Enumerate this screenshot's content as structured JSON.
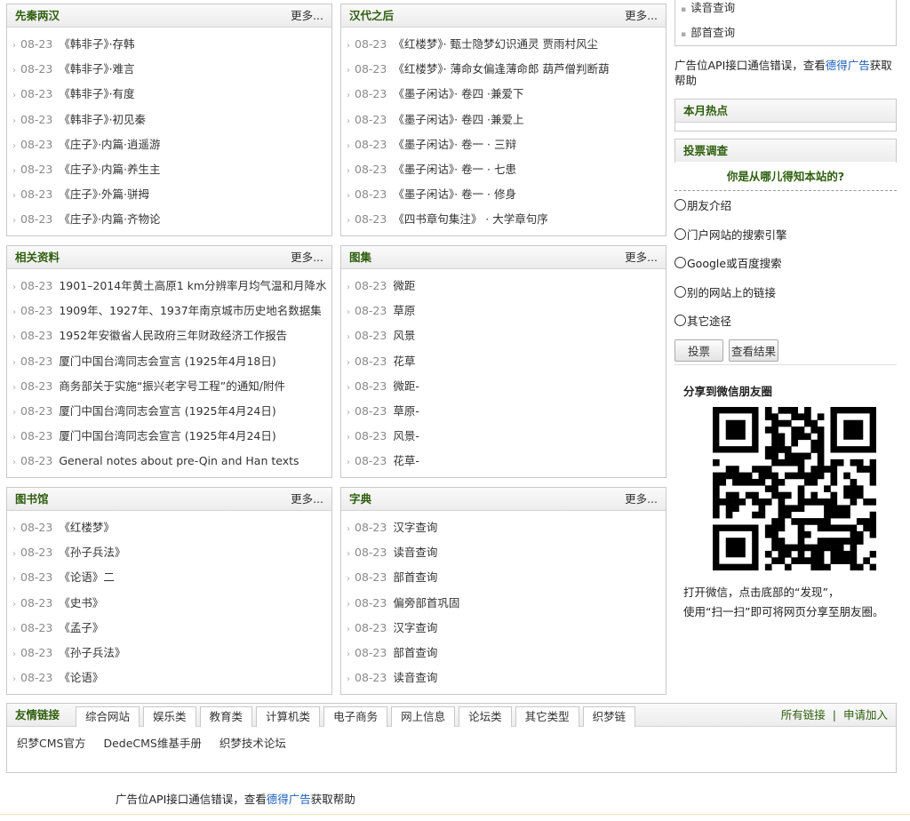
{
  "panels": [
    {
      "title": "先秦两汉",
      "more": "更多...",
      "items": [
        {
          "date": "08-23",
          "text": "《韩非子》·存韩"
        },
        {
          "date": "08-23",
          "text": "《韩非子》·难言"
        },
        {
          "date": "08-23",
          "text": "《韩非子》·有度"
        },
        {
          "date": "08-23",
          "text": "《韩非子》·初见秦"
        },
        {
          "date": "08-23",
          "text": "《庄子》·内篇·逍遥游"
        },
        {
          "date": "08-23",
          "text": "《庄子》·内篇·养生主"
        },
        {
          "date": "08-23",
          "text": "《庄子》·外篇·骈拇"
        },
        {
          "date": "08-23",
          "text": "《庄子》·内篇·齐物论"
        }
      ]
    },
    {
      "title": "汉代之后",
      "more": "更多...",
      "items": [
        {
          "date": "08-23",
          "text": "《红楼梦》· 甄士隐梦幻识通灵  贾雨村风尘"
        },
        {
          "date": "08-23",
          "text": "《红楼梦》· 薄命女偏逢薄命郎  葫芦僧判断葫"
        },
        {
          "date": "08-23",
          "text": "《墨子闲诂》· 卷四 ·兼爱下"
        },
        {
          "date": "08-23",
          "text": "《墨子闲诂》· 卷四 ·兼爱上"
        },
        {
          "date": "08-23",
          "text": "《墨子闲诂》· 卷一 · 三辩"
        },
        {
          "date": "08-23",
          "text": "《墨子闲诂》· 卷一 · 七患"
        },
        {
          "date": "08-23",
          "text": "《墨子闲诂》· 卷一 · 修身"
        },
        {
          "date": "08-23",
          "text": "《四书章句集注》 · 大学章句序"
        }
      ]
    },
    {
      "title": "相关资料",
      "more": "更多...",
      "items": [
        {
          "date": "08-23",
          "text": "1901–2014年黄土高原1 km分辨率月均气温和月降水"
        },
        {
          "date": "08-23",
          "text": "1909年、1927年、1937年南京城市历史地名数据集"
        },
        {
          "date": "08-23",
          "text": "1952年安徽省人民政府三年财政经济工作报告"
        },
        {
          "date": "08-23",
          "text": "厦门中国台湾同志会宣言 (1925年4月18日)"
        },
        {
          "date": "08-23",
          "text": "商务部关于实施“振兴老字号工程”的通知/附件"
        },
        {
          "date": "08-23",
          "text": "厦门中国台湾同志会宣言 (1925年4月24日)"
        },
        {
          "date": "08-23",
          "text": "厦门中国台湾同志会宣言 (1925年4月24日)"
        },
        {
          "date": "08-23",
          "text": "General notes about pre-Qin and Han texts"
        }
      ]
    },
    {
      "title": "图集",
      "more": "更多...",
      "items": [
        {
          "date": "08-23",
          "text": "微距"
        },
        {
          "date": "08-23",
          "text": "草原"
        },
        {
          "date": "08-23",
          "text": "风景"
        },
        {
          "date": "08-23",
          "text": "花草"
        },
        {
          "date": "08-23",
          "text": "微距-"
        },
        {
          "date": "08-23",
          "text": "草原-"
        },
        {
          "date": "08-23",
          "text": "风景-"
        },
        {
          "date": "08-23",
          "text": "花草-"
        }
      ]
    },
    {
      "title": "图书馆",
      "more": "更多...",
      "items": [
        {
          "date": "08-23",
          "text": "《红楼梦》"
        },
        {
          "date": "08-23",
          "text": "《孙子兵法》"
        },
        {
          "date": "08-23",
          "text": "《论语》二"
        },
        {
          "date": "08-23",
          "text": "《史书》"
        },
        {
          "date": "08-23",
          "text": "《孟子》"
        },
        {
          "date": "08-23",
          "text": "《孙子兵法》"
        },
        {
          "date": "08-23",
          "text": "《论语》"
        }
      ]
    },
    {
      "title": "字典",
      "more": "更多...",
      "items": [
        {
          "date": "08-23",
          "text": "汉字查询"
        },
        {
          "date": "08-23",
          "text": "读音查询"
        },
        {
          "date": "08-23",
          "text": "部首查询"
        },
        {
          "date": "08-23",
          "text": "偏旁部首巩固"
        },
        {
          "date": "08-23",
          "text": "汉字查询"
        },
        {
          "date": "08-23",
          "text": "部首查询"
        },
        {
          "date": "08-23",
          "text": "读音查询"
        }
      ]
    }
  ],
  "sidebar": {
    "top_links": [
      "读音查询",
      "部首查询"
    ],
    "ad_prefix": "广告位API接口通信错误，查看",
    "ad_link": "德得广告",
    "ad_suffix": "获取帮助",
    "hot_title": "本月热点",
    "vote_title": "投票调查",
    "vote_question": "你是从哪儿得知本站的?",
    "vote_options": [
      "朋友介绍",
      "门户网站的搜索引擎",
      "Google或百度搜索",
      "别的网站上的链接",
      "其它途径"
    ],
    "vote_button": "投票",
    "result_button": "查看结果",
    "share_title": "分享到微信朋友圈",
    "share_line1": "打开微信，点击底部的“发现”，",
    "share_line2": "使用“扫一扫”即可将网页分享至朋友圈。"
  },
  "friendlinks": {
    "title": "友情链接",
    "tabs": [
      "综合网站",
      "娱乐类",
      "教育类",
      "计算机类",
      "电子商务",
      "网上信息",
      "论坛类",
      "其它类型",
      "织梦链"
    ],
    "all_links": "所有链接",
    "separator": "|",
    "apply": "申请加入",
    "links": [
      "织梦CMS官方",
      "DedeCMS维基手册",
      "织梦技术论坛"
    ]
  },
  "footer": {
    "ad_prefix": "广告位API接口通信错误，查看",
    "ad_link": "德得广告",
    "ad_suffix": "获取帮助"
  },
  "colors": {
    "heading_green": "#2f5f0f",
    "link_blue": "#1a5eb8",
    "border": "#c9c9c9",
    "date_gray": "#8a8a8a"
  }
}
